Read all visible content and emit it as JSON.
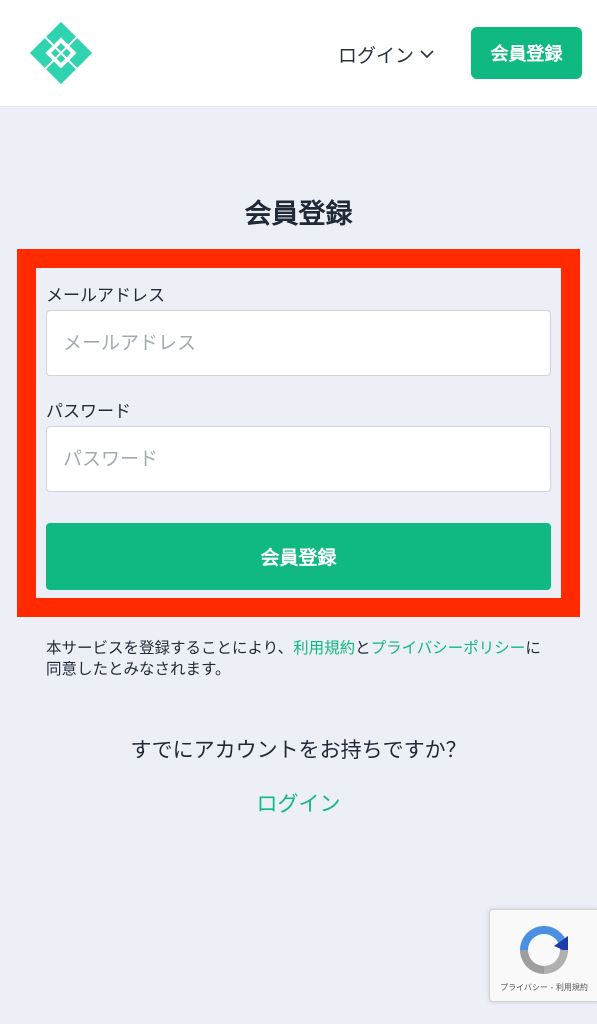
{
  "header": {
    "logo_icon": "diamond-logo-icon",
    "login_label": "ログイン",
    "login_dropdown_icon": "chevron-down-icon",
    "register_label": "会員登録"
  },
  "colors": {
    "accent": "#10b981",
    "highlight_border": "#ff2a00",
    "background": "#eceff5"
  },
  "form": {
    "title": "会員登録",
    "email_label": "メールアドレス",
    "email_placeholder": "メールアドレス",
    "email_value": "",
    "password_label": "パスワード",
    "password_placeholder": "パスワード",
    "password_value": "",
    "submit_label": "会員登録"
  },
  "terms": {
    "prefix": "本サービスを登録することにより、",
    "terms_link": "利用規約",
    "middle": "と",
    "privacy_link": "プライバシーポリシー",
    "suffix": "に同意したとみなされます。"
  },
  "footer": {
    "already_text": "すでにアカウントをお持ちですか？",
    "login_link": "ログイン"
  },
  "recaptcha": {
    "icon": "recaptcha-icon",
    "text": "プライバシー - 利用規約"
  }
}
